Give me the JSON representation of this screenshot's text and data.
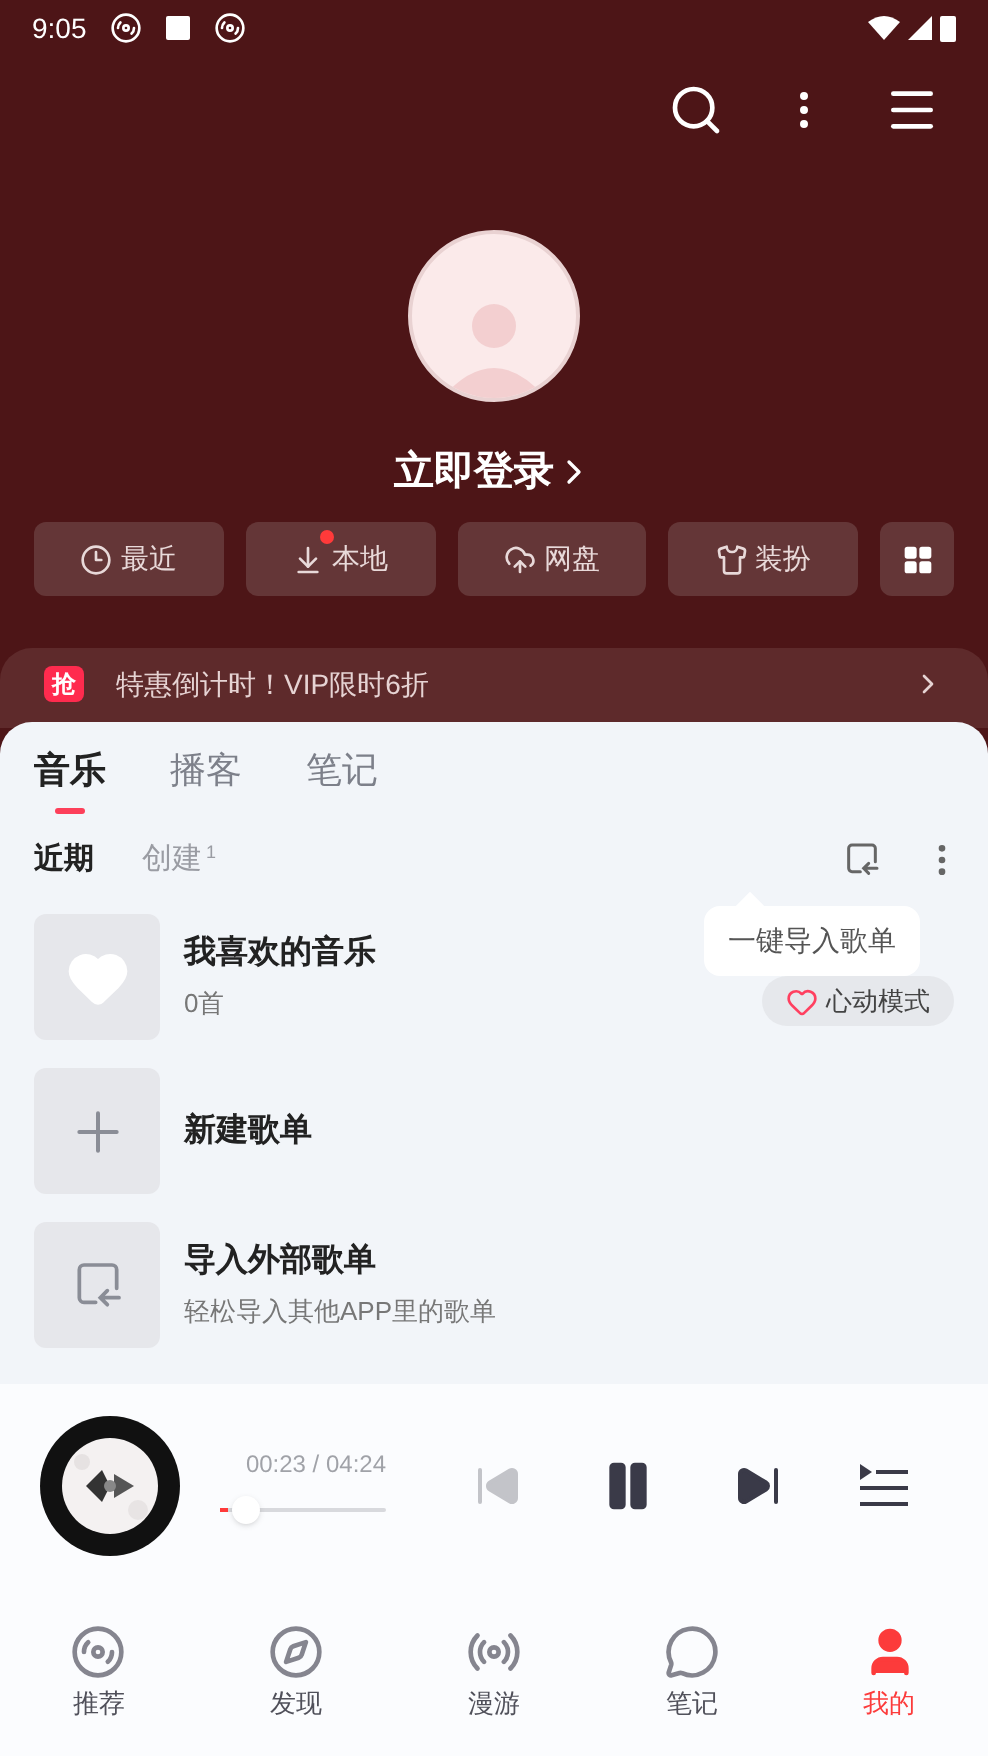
{
  "status_bar": {
    "time": "9:05"
  },
  "profile": {
    "login_text": "立即登录"
  },
  "quick_actions": [
    {
      "kind": "recent",
      "label": "最近",
      "dot": false
    },
    {
      "kind": "local",
      "label": "本地",
      "dot": true
    },
    {
      "kind": "cloud",
      "label": "网盘",
      "dot": false
    },
    {
      "kind": "dress",
      "label": "装扮",
      "dot": false
    }
  ],
  "promo": {
    "badge": "抢",
    "text": "特惠倒计时！VIP限时6折"
  },
  "tabs": [
    {
      "label": "音乐",
      "selected": true
    },
    {
      "label": "播客",
      "selected": false
    },
    {
      "label": "笔记",
      "selected": false
    }
  ],
  "subtabs": [
    {
      "label": "近期",
      "selected": true
    },
    {
      "label": "创建",
      "count": "1",
      "selected": false
    }
  ],
  "tooltip": "一键导入歌单",
  "playlists": [
    {
      "kind": "liked",
      "title": "我喜欢的音乐",
      "subtitle": "0首",
      "action": "心动模式"
    },
    {
      "kind": "new",
      "title": "新建歌单"
    },
    {
      "kind": "import",
      "title": "导入外部歌单",
      "subtitle": "轻松导入其他APP里的歌单"
    }
  ],
  "player": {
    "time": "00:23 / 04:24",
    "level": 0.05,
    "prev_disabled": true
  },
  "nav": [
    {
      "kind": "recommend",
      "label": "推荐",
      "selected": false
    },
    {
      "kind": "discover",
      "label": "发现",
      "selected": false
    },
    {
      "kind": "roam",
      "label": "漫游",
      "selected": false
    },
    {
      "kind": "notes",
      "label": "笔记",
      "selected": false
    },
    {
      "kind": "mine",
      "label": "我的",
      "selected": true
    }
  ]
}
